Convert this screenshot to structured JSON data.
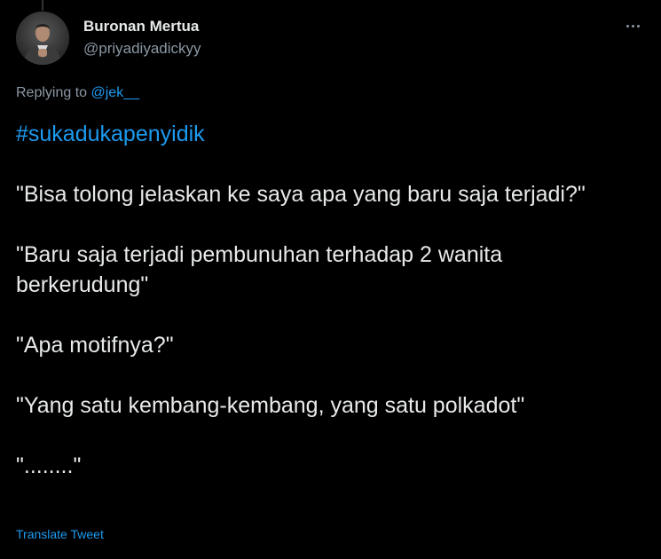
{
  "tweet": {
    "display_name": "Buronan Mertua",
    "handle": "@priyadiyadickyy",
    "replying_to_prefix": "Replying to ",
    "replying_to_handle": "@jek__",
    "hashtag": "#sukadukapenyidik",
    "paragraphs": [
      "\"Bisa tolong jelaskan ke saya apa yang baru saja terjadi?\"",
      "\"Baru saja terjadi pembunuhan terhadap 2 wanita berkerudung\"",
      "\"Apa motifnya?\"",
      "\"Yang satu kembang-kembang, yang satu polkadot\"",
      "\"........\""
    ],
    "translate_label": "Translate Tweet"
  },
  "icons": {
    "avatar": "profile-photo",
    "more": "more-dots-icon"
  },
  "colors": {
    "background": "#000000",
    "text": "#e7e9ea",
    "secondary_text": "#8b98a5",
    "link": "#1d9bf0"
  }
}
